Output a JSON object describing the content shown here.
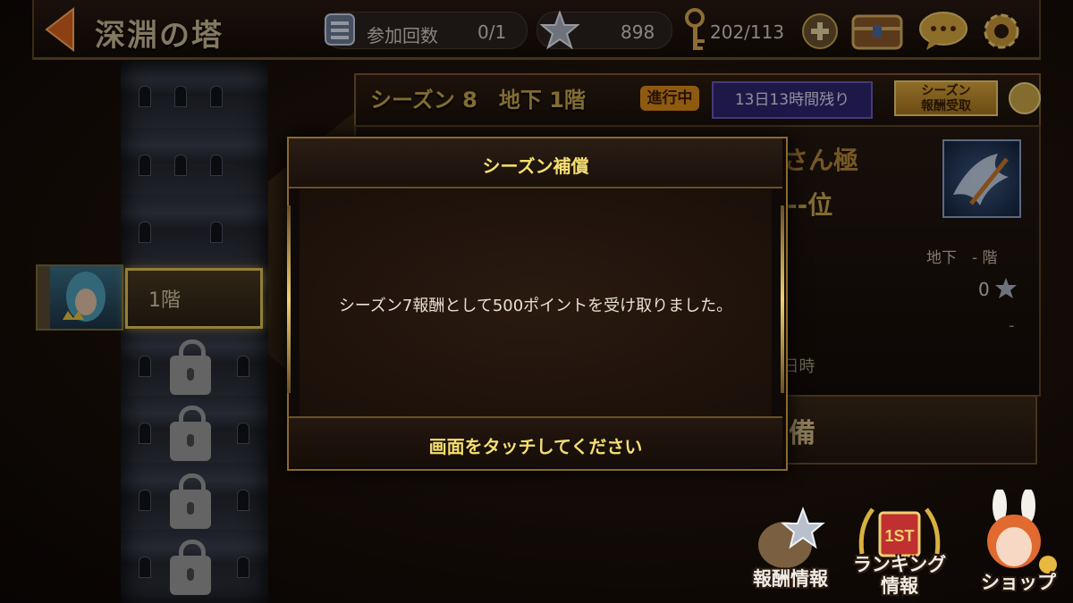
{
  "header": {
    "title": "深淵の塔",
    "participation_label": "参加回数",
    "participation_value": "0/1",
    "star_value": "898",
    "key_value": "202/113"
  },
  "season": {
    "title": "シーズン 8　地下 1階",
    "status": "進行中",
    "time_left": "13日13時間残り",
    "reward_button_line1": "シーズン",
    "reward_button_line2": "報酬受取"
  },
  "panel": {
    "rank_name": "さんさん極",
    "rank_position": "--位",
    "floor_info": "地下　- 階",
    "points": "0",
    "dash": "-",
    "time_fragment": "7日時",
    "prep_label": "準備"
  },
  "tower": {
    "floor1_label": "1階"
  },
  "modal": {
    "title": "シーズン補償",
    "message": "シーズン7報酬として500ポイントを受け取りました。",
    "touch_prompt": "画面をタッチしてください"
  },
  "bottom_menu": {
    "reward_info": "報酬情報",
    "ranking_line1": "ランキング",
    "ranking_line2": "情報",
    "shop": "ショップ"
  },
  "colors": {
    "gold": "#f5df70",
    "status_orange": "#d98a1a",
    "time_purple": "#2f2570"
  }
}
